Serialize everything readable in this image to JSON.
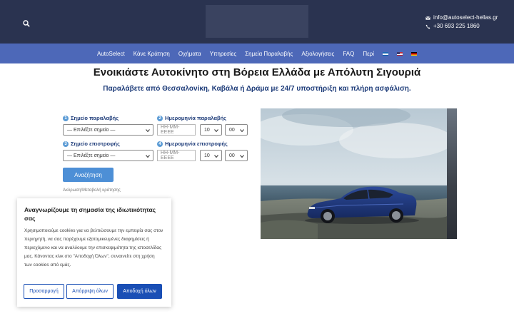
{
  "header": {
    "search_icon": "search-icon",
    "email": "info@autoselect-hellas.gr",
    "phone": "+30 693 225 1860",
    "email_icon": "envelope-icon",
    "phone_icon": "phone-icon"
  },
  "nav": {
    "items": [
      "AutoSelect",
      "Κάνε Κράτηση",
      "Οχήματα",
      "Υπηρεσίες",
      "Σημεία Παραλαβής",
      "Αξιολογήσεις",
      "FAQ",
      "Περί"
    ],
    "languages": [
      "greek-flag",
      "english-flag",
      "german-flag"
    ]
  },
  "hero": {
    "title": "Ενοικιάστε Αυτοκίνητο στη Βόρεια Ελλάδα με Απόλυτη Σιγουριά",
    "subtitle": "Παραλάβετε από Θεσσαλονίκη, Καβάλα ή Δράμα με 24/7 υποστήριξη και πλήρη ασφάλιση."
  },
  "booking": {
    "pickup_point": {
      "num": "1",
      "label": "Σημείο παραλαβής",
      "value": "— Επιλέξτε σημείο —"
    },
    "pickup_date": {
      "num": "2",
      "label": "Ημερομηνία παραλαβής",
      "placeholder": "HH-MM-EEEE",
      "hour": "10",
      "minute": "00"
    },
    "return_point": {
      "num": "3",
      "label": "Σημείο επιστροφής",
      "value": "— Επιλέξτε σημείο —"
    },
    "return_date": {
      "num": "4",
      "label": "Ημερομηνία επιστροφής",
      "placeholder": "HH-MM-EEEE",
      "hour": "10",
      "minute": "00"
    },
    "search_label": "Αναζήτηση",
    "manage_link": "Ακύρωση/Μεταβολή κράτησης"
  },
  "cookie": {
    "title": "Αναγνωρίζουμε τη σημασία της ιδιωτικότητας σας",
    "text": "Χρησιμοποιούμε cookies για να βελτιώσουμε την εμπειρία σας στον περιηγητή, να σας παρέχουμε εξατομικευμένες διαφημίσεις ή περιεχόμενο και να αναλύουμε την επισκεψιμότητα της ιστοσελίδας μας. Κάνοντας κλικ στο \"Αποδοχή Όλων\", συναινείτε στη χρήση των cookies από εμάς.",
    "customize_label": "Προσαρμογή",
    "reject_label": "Απόρριψη όλων",
    "accept_label": "Αποδοχή όλων"
  },
  "colors": {
    "topbar": "#2a3350",
    "navbar": "#4d68b8",
    "accent": "#1a4fb5",
    "subtitle": "#1f3d7a"
  }
}
